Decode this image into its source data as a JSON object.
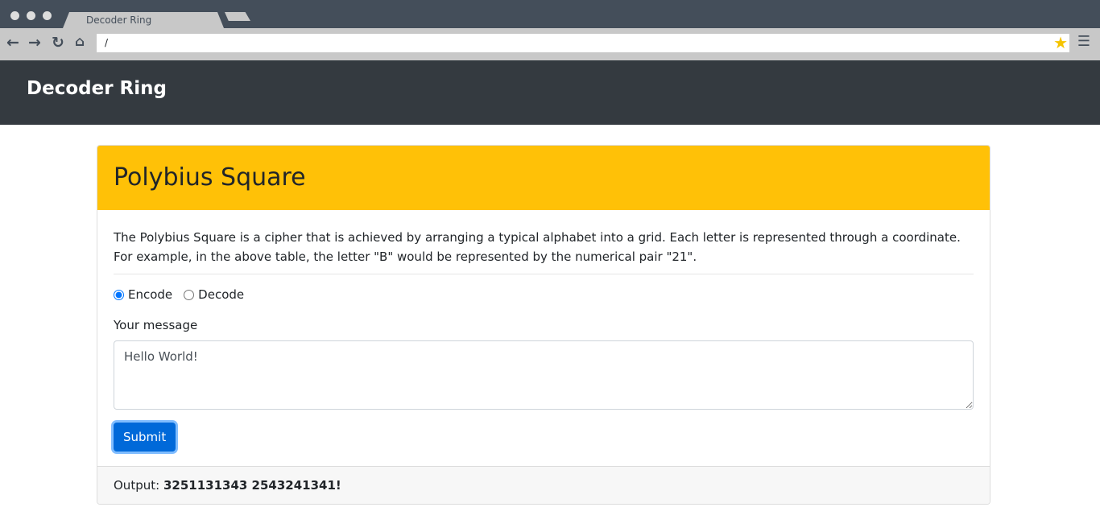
{
  "browser": {
    "tab_title": "Decoder Ring",
    "url": "/"
  },
  "navbar": {
    "brand": "Decoder Ring"
  },
  "card": {
    "title": "Polybius Square",
    "description": "The Polybius Square is a cipher that is achieved by arranging a typical alphabet into a grid. Each letter is represented through a coordinate. For example, in the above table, the letter \"B\" would be represented by the numerical pair \"21\".",
    "modes": [
      {
        "label": "Encode",
        "checked": true
      },
      {
        "label": "Decode",
        "checked": false
      }
    ],
    "message_label": "Your message",
    "message_value": "Hello World!",
    "submit_label": "Submit",
    "output_label": "Output:",
    "output_value": "3251131343 2543241341!"
  }
}
